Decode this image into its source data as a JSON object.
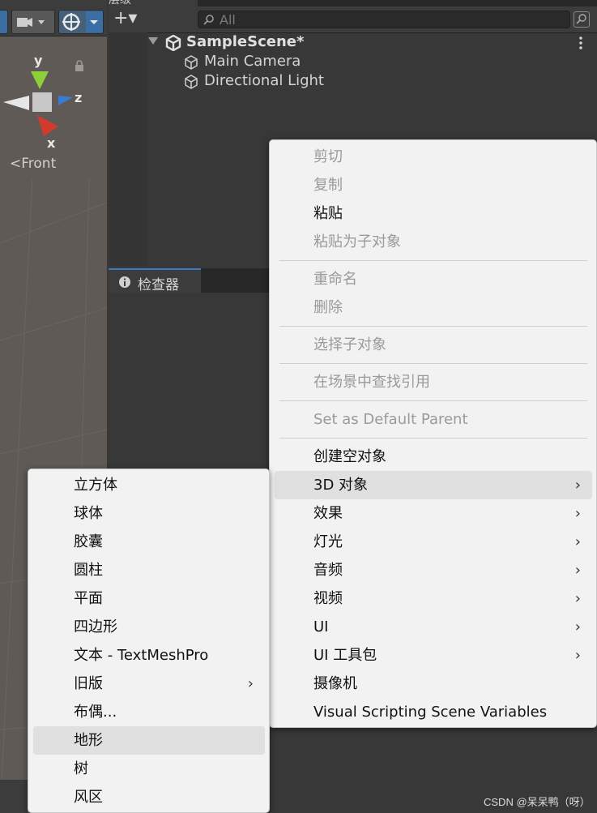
{
  "scene_view": {
    "axis_y": "y",
    "axis_z": "z",
    "axis_x": "x",
    "view_label": "<Front"
  },
  "hierarchy": {
    "tab_title": "层级",
    "add_label": "+▾",
    "search_placeholder": "All",
    "scene_name": "SampleScene*",
    "items": [
      {
        "label": "Main Camera"
      },
      {
        "label": "Directional Light"
      }
    ]
  },
  "inspector": {
    "tab_title": "检查器"
  },
  "context_menu": {
    "items": [
      {
        "label": "剪切",
        "enabled": false
      },
      {
        "label": "复制",
        "enabled": false
      },
      {
        "label": "粘贴",
        "enabled": true
      },
      {
        "label": "粘贴为子对象",
        "enabled": false
      },
      {
        "label": "重命名",
        "enabled": false
      },
      {
        "label": "删除",
        "enabled": false
      },
      {
        "label": "选择子对象",
        "enabled": false
      },
      {
        "label": "在场景中查找引用",
        "enabled": false
      },
      {
        "label": "Set as Default Parent",
        "enabled": false
      },
      {
        "label": "创建空对象",
        "enabled": true
      },
      {
        "label": "3D 对象",
        "enabled": true,
        "submenu": true,
        "highlighted": true
      },
      {
        "label": "效果",
        "enabled": true,
        "submenu": true
      },
      {
        "label": "灯光",
        "enabled": true,
        "submenu": true
      },
      {
        "label": "音频",
        "enabled": true,
        "submenu": true
      },
      {
        "label": "视频",
        "enabled": true,
        "submenu": true
      },
      {
        "label": "UI",
        "enabled": true,
        "submenu": true
      },
      {
        "label": "UI 工具包",
        "enabled": true,
        "submenu": true
      },
      {
        "label": "摄像机",
        "enabled": true
      },
      {
        "label": "Visual Scripting Scene Variables",
        "enabled": true
      }
    ],
    "submenu_arrow": "›"
  },
  "submenu_3d": {
    "items": [
      {
        "label": "立方体"
      },
      {
        "label": "球体"
      },
      {
        "label": "胶囊"
      },
      {
        "label": "圆柱"
      },
      {
        "label": "平面"
      },
      {
        "label": "四边形"
      },
      {
        "label": "文本 - TextMeshPro"
      },
      {
        "label": "旧版",
        "submenu": true
      },
      {
        "label": "布偶..."
      },
      {
        "label": "地形",
        "highlighted": true
      },
      {
        "label": "树"
      },
      {
        "label": "风区"
      }
    ]
  },
  "watermark": "CSDN @呆呆鸭（呀）",
  "colors": {
    "menu_bg": "#f2f2f2",
    "menu_highlight": "#e0e0e0",
    "disabled_text": "#9a9a9a",
    "editor_bg": "#383838",
    "scene_bg": "#5f5a55",
    "axis_x": "#d23b2c",
    "axis_y": "#8ccf3a",
    "axis_z": "#3a7bd5"
  }
}
